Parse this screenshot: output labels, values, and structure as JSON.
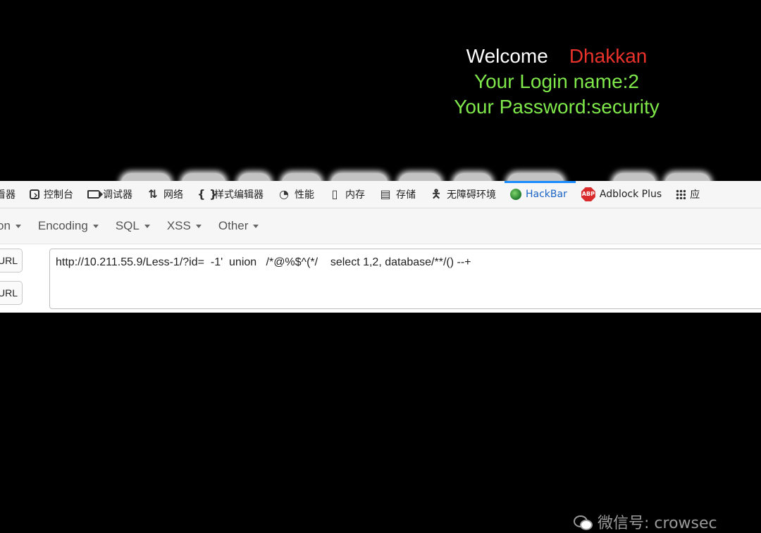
{
  "page": {
    "welcome_word": "Welcome",
    "welcome_user": "Dhakkan",
    "login_line": "Your Login name:2",
    "password_line": "Your Password:security"
  },
  "devtools_tabs": [
    {
      "label": "看器",
      "icon": "inspector-icon"
    },
    {
      "label": "控制台",
      "icon": "console-icon"
    },
    {
      "label": "调试器",
      "icon": "debugger-icon"
    },
    {
      "label": "网络",
      "icon": "network-icon"
    },
    {
      "label": "样式编辑器",
      "icon": "style-editor-icon"
    },
    {
      "label": "性能",
      "icon": "performance-icon"
    },
    {
      "label": "内存",
      "icon": "memory-icon"
    },
    {
      "label": "存储",
      "icon": "storage-icon"
    },
    {
      "label": "无障碍环境",
      "icon": "accessibility-icon"
    },
    {
      "label": "HackBar",
      "icon": "hackbar-icon",
      "active": true
    },
    {
      "label": "Adblock Plus",
      "icon": "adblock-icon"
    },
    {
      "label": "应",
      "icon": "apps-grid-icon"
    }
  ],
  "hackbar_menu": [
    "on",
    "Encoding",
    "SQL",
    "XSS",
    "Other"
  ],
  "buttons": {
    "load_url": "URL",
    "split_url": "URL"
  },
  "url_value": "http://10.211.55.9/Less-1/?id=  -1'  union   /*@%$^(*/    select 1,2, database/**/() --+",
  "watermark": "微信号: crowsec",
  "colors": {
    "background": "#000000",
    "welcome_user": "#e8322a",
    "green_text": "#7fe84a",
    "active_tab": "#1a64c6"
  }
}
